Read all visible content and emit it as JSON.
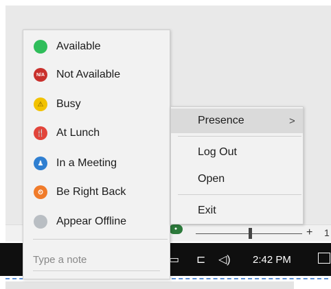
{
  "presence_menu": {
    "items": [
      {
        "label": "Available",
        "glyph": "",
        "color": "#2fbd5a",
        "icon": "available-icon"
      },
      {
        "label": "Not Available",
        "glyph": "N/A",
        "color": "#c9302c",
        "icon": "not-available-icon"
      },
      {
        "label": "Busy",
        "glyph": "⚠",
        "color": "#f2c200",
        "icon": "busy-icon"
      },
      {
        "label": "At Lunch",
        "glyph": "🍴",
        "color": "#e2443a",
        "icon": "lunch-icon"
      },
      {
        "label": "In a Meeting",
        "glyph": "♟",
        "color": "#2f7fd1",
        "icon": "meeting-icon"
      },
      {
        "label": "Be Right Back",
        "glyph": "⏲",
        "color": "#f07b2a",
        "icon": "clock-icon"
      },
      {
        "label": "Appear Offline",
        "glyph": "",
        "color": "#b9bec3",
        "icon": "offline-icon"
      }
    ],
    "note_placeholder": "Type a note"
  },
  "context_menu": {
    "presence": "Presence",
    "presence_arrow": ">",
    "log_out": "Log Out",
    "open": "Open",
    "exit": "Exit"
  },
  "app_strip": {
    "zoom_plus": "+",
    "zoom_percent_partial": "1"
  },
  "taskbar": {
    "clock": "2:42 PM"
  }
}
